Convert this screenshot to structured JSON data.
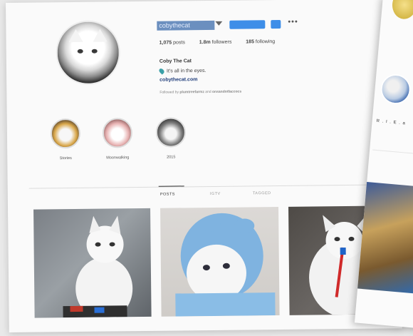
{
  "profile": {
    "username": "cobythecat",
    "posts_count": "1,075",
    "posts_label": "posts",
    "followers_count": "1.8m",
    "followers_label": "followers",
    "following_count": "185",
    "following_label": "following",
    "name": "Coby The Cat",
    "bio": "It's all in the eyes.",
    "website": "cobythecat.com",
    "followed_by_prefix": "Followed by",
    "followed_by_a": "plumtreefarmz",
    "followed_by_and": "and",
    "followed_by_b": "onsandotfaccocs"
  },
  "actions": {
    "more_label": "•••"
  },
  "highlights": [
    {
      "label": "Stories"
    },
    {
      "label": "Moonwalking"
    },
    {
      "label": "2015"
    }
  ],
  "tabs": [
    {
      "label": "POSTS"
    },
    {
      "label": "IGTV"
    },
    {
      "label": "TAGGED"
    }
  ],
  "second_profile": {
    "name_fragment": "R . I . E . a"
  },
  "colors": {
    "primary_button": "#3e8ee8",
    "link": "#1e3c7a",
    "location_icon": "#3aa0a8"
  }
}
